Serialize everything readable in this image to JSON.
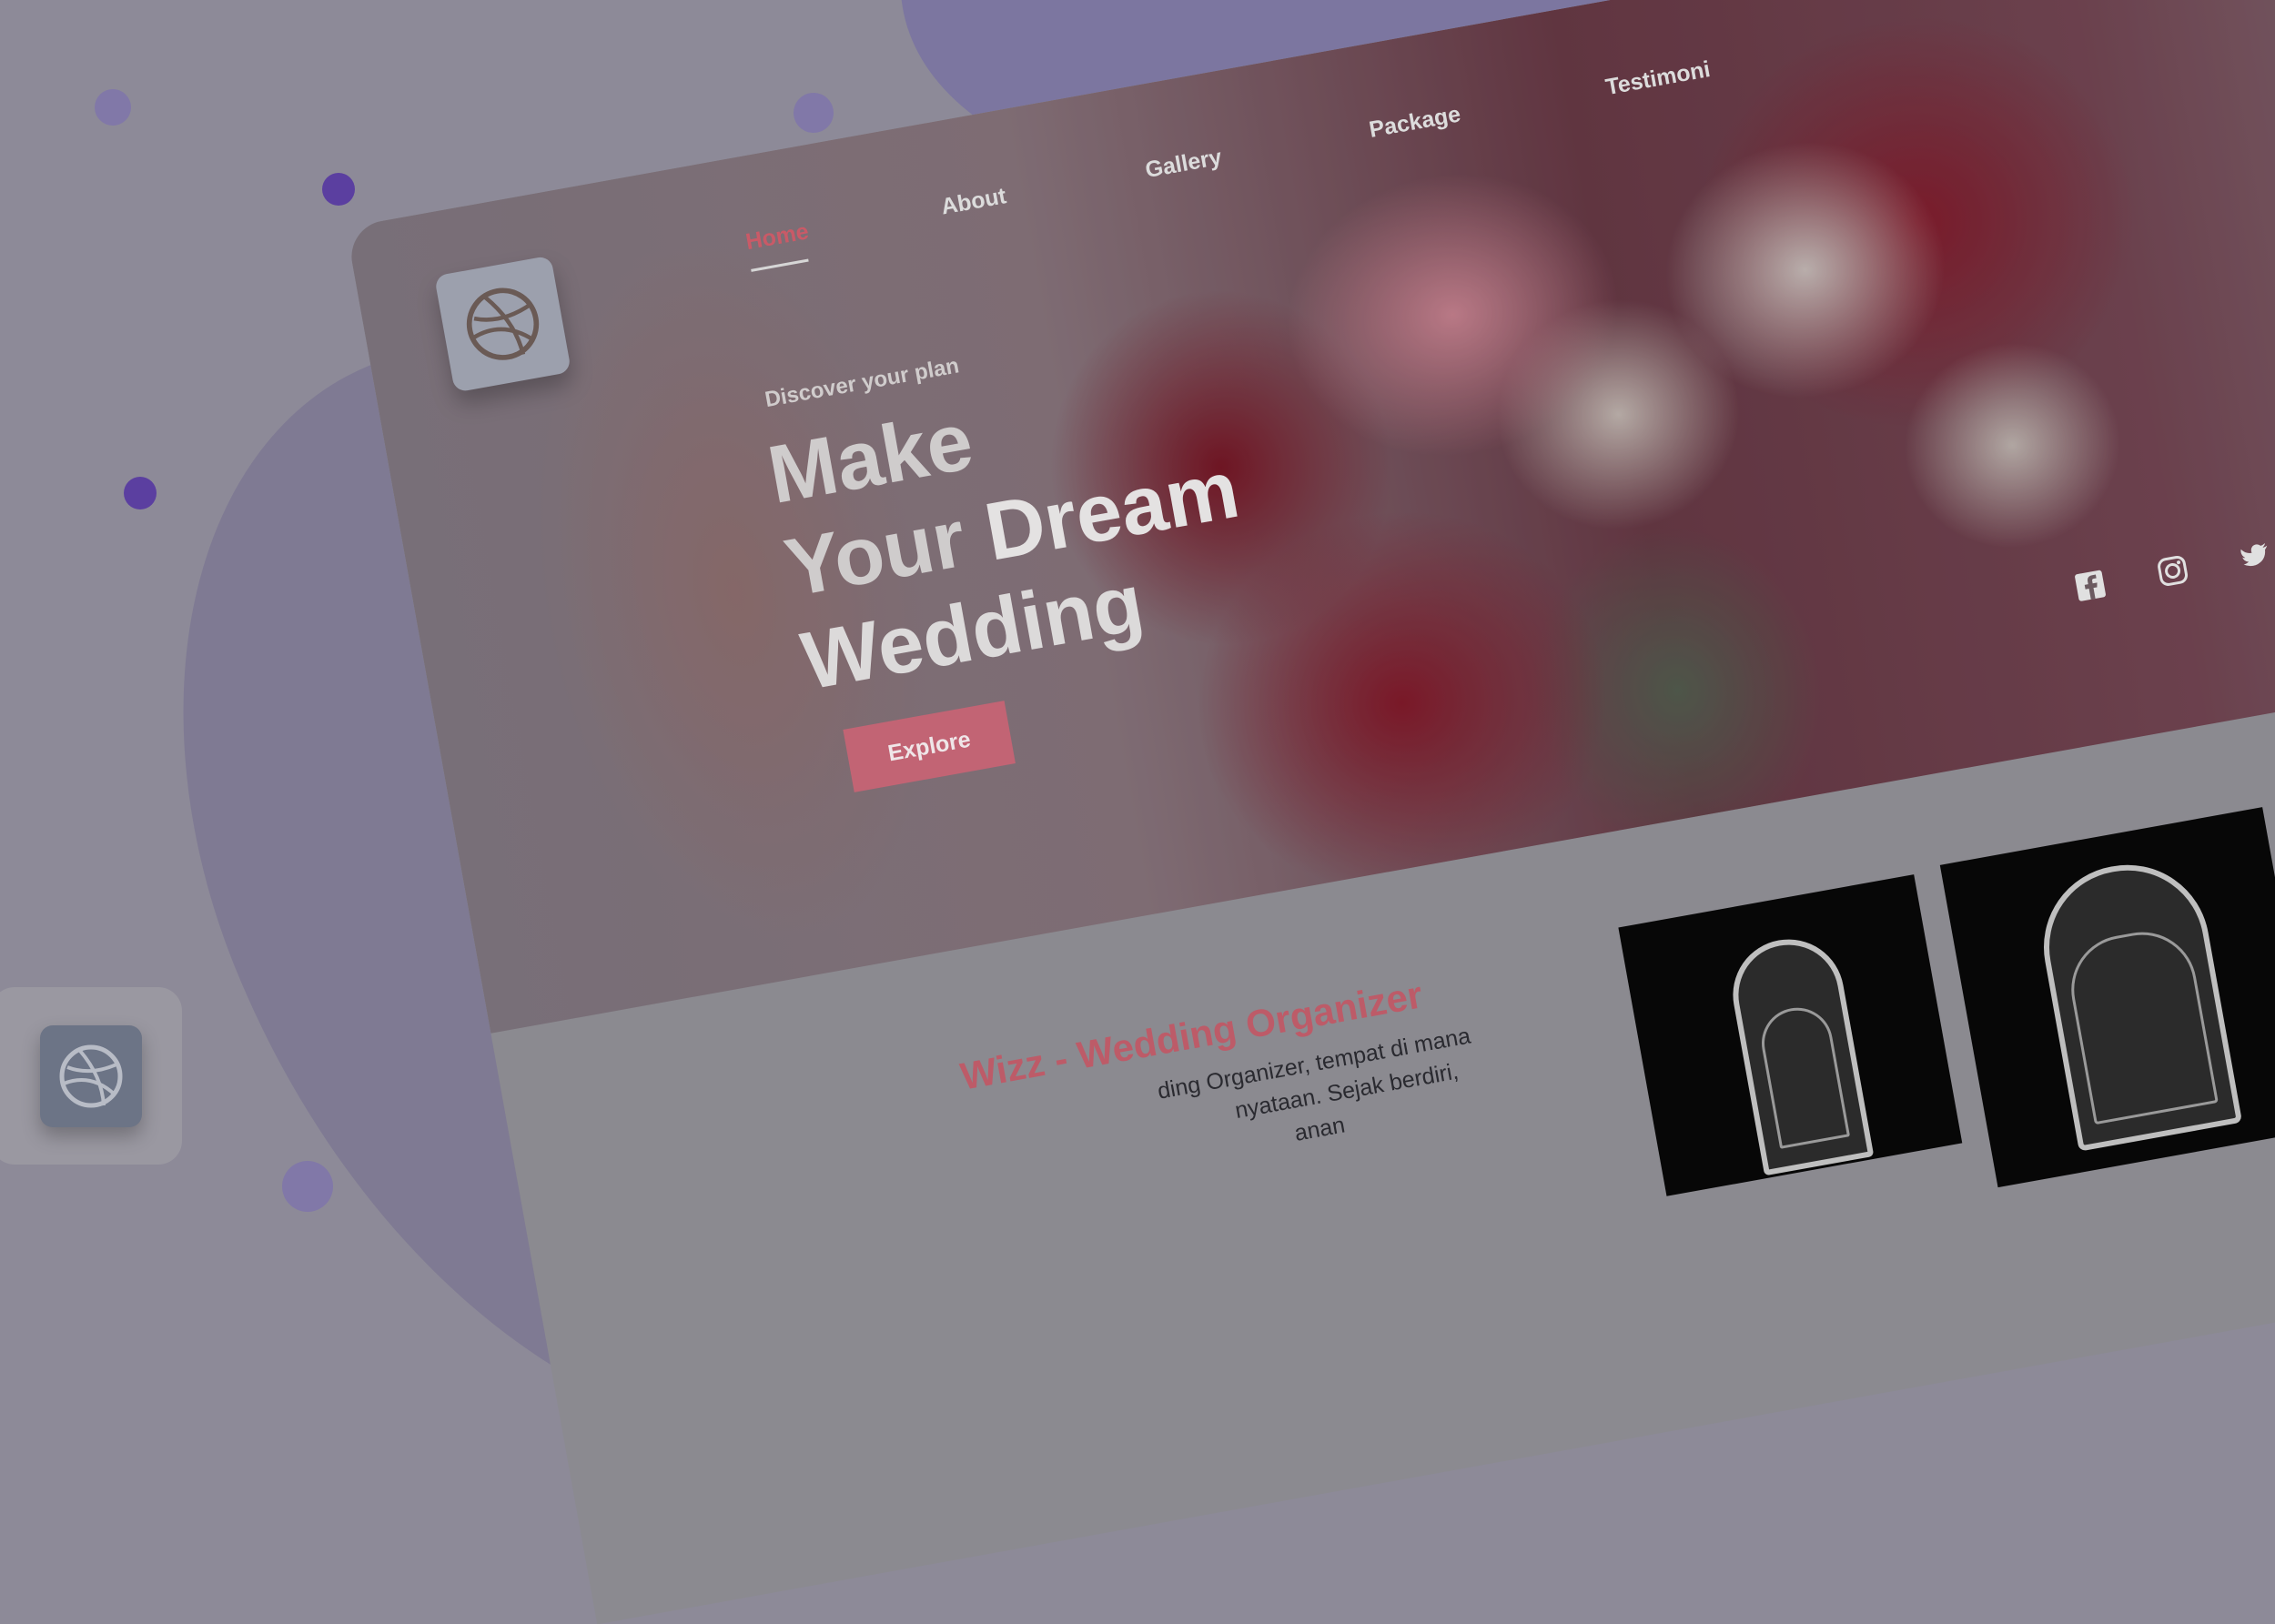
{
  "nav": {
    "items": [
      "Home",
      "About",
      "Gallery",
      "Package",
      "Testimoni"
    ],
    "active": "Home"
  },
  "hero": {
    "eyebrow": "Discover your plan",
    "line1": "Make",
    "line2a": "Your ",
    "line2b": "Dream",
    "line3": "Wedding",
    "cta": "Explore"
  },
  "social": [
    "facebook-icon",
    "instagram-icon",
    "twitter-icon"
  ],
  "about": {
    "title": "Wizz - Wedding Organizer",
    "text_line1": "ding Organizer, tempat di mana",
    "text_line2": "nyataan. Sejak berdiri,",
    "text_line3": "anan"
  },
  "colors": {
    "accent": "#c95a67",
    "button": "#c26474",
    "dots": "#5b3fa0"
  }
}
